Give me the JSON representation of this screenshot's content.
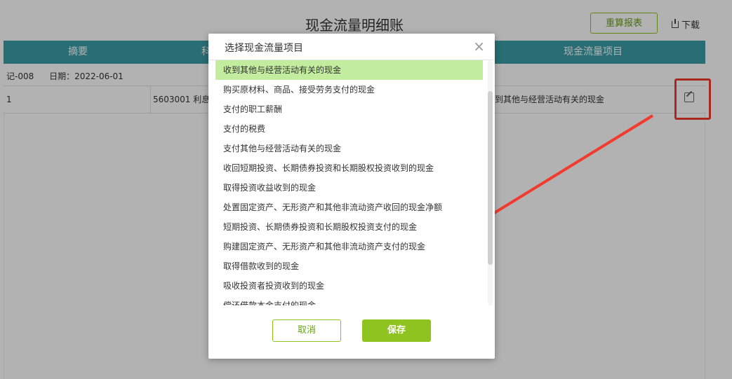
{
  "page": {
    "title": "现金流量明细账",
    "recalc_button": "重算报表",
    "download": "下载"
  },
  "table": {
    "headers": [
      "摘要",
      "科",
      "现金流量项目"
    ],
    "voucher": "记-008",
    "date": "日期：2022-06-01",
    "row": {
      "index": "1",
      "account": "5603001 利息",
      "cash_item": "到其他与经营活动有关的现金"
    }
  },
  "modal": {
    "title": "选择现金流量项目",
    "close": "×",
    "items": [
      "收到其他与经营活动有关的现金",
      "购买原材料、商品、接受劳务支付的现金",
      "支付的职工薪酬",
      "支付的税费",
      "支付其他与经营活动有关的现金",
      "收回短期投资、长期债券投资和长期股权投资收到的现金",
      "取得投资收益收到的现金",
      "处置固定资产、无形资产和其他非流动资产收回的现金净额",
      "短期投资、长期债券投资和长期股权投资支付的现金",
      "购建固定资产、无形资产和其他非流动资产支付的现金",
      "取得借款收到的现金",
      "吸收投资者投资收到的现金",
      "偿还借款本金支付的现金"
    ],
    "selected_index": 0,
    "cancel": "取消",
    "save": "保存"
  },
  "colors": {
    "header_teal": "#3a9ea6",
    "accent_green": "#8fc31f",
    "selected_green": "#c2ec9e",
    "annotation_red": "#f23a2e"
  }
}
